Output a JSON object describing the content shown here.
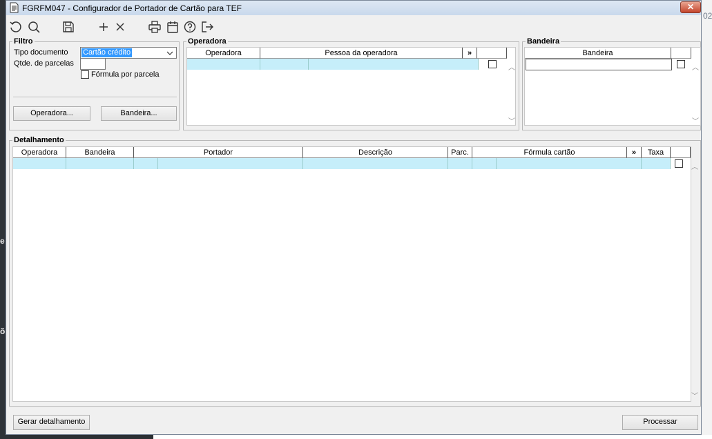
{
  "window": {
    "title": "FGRFM047 - Configurador de Portador de Cartão para TEF",
    "close_label": "✕"
  },
  "background": {
    "right_text": "02",
    "letters": [
      "e",
      "õ"
    ]
  },
  "toolbar": {
    "buttons": [
      "refresh-icon",
      "search-icon",
      "save-icon",
      "add-icon",
      "delete-icon",
      "print-icon",
      "calendar-icon",
      "help-icon",
      "exit-icon"
    ]
  },
  "filtro": {
    "legend": "Filtro",
    "tipo_documento_label": "Tipo documento",
    "tipo_documento_value": "Cartão crédito",
    "qtde_parcelas_label": "Qtde. de parcelas",
    "qtde_parcelas_value": "",
    "formula_label": "Fórmula por parcela",
    "operadora_button": "Operadora...",
    "bandeira_button": "Bandeira..."
  },
  "operadora": {
    "legend": "Operadora",
    "columns": [
      "Operadora",
      "Pessoa da operadora"
    ],
    "more": "»"
  },
  "bandeira": {
    "legend": "Bandeira",
    "columns": [
      "Bandeira"
    ]
  },
  "detalhamento": {
    "legend": "Detalhamento",
    "columns": [
      "Operadora",
      "Bandeira",
      "Portador",
      "Descrição",
      "Parc.",
      "Fórmula cartão",
      "Taxa"
    ],
    "more": "»"
  },
  "footer": {
    "gerar_button": "Gerar detalhamento",
    "processar_button": "Processar"
  },
  "colors": {
    "selected_row": "#c6eefa",
    "dropdown_highlight": "#3399ff"
  }
}
